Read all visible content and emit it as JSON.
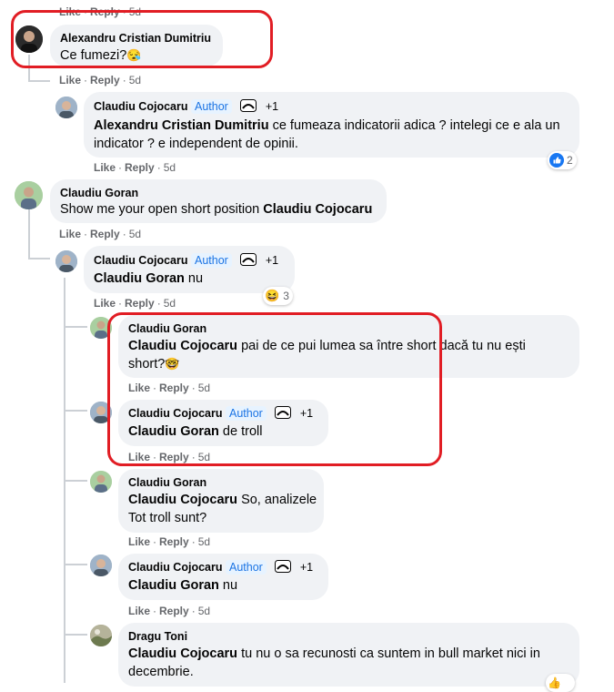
{
  "top_actions": {
    "like": "Like",
    "reply": "Reply",
    "time": "5d"
  },
  "c1": {
    "author": "Alexandru Cristian Dumitriu",
    "text": "Ce fumezi?",
    "emoji": "😪",
    "like": "Like",
    "reply": "Reply",
    "time": "5d"
  },
  "c2": {
    "author": "Claudiu Cojocaru",
    "badge": "Author",
    "plus": "+1",
    "mention": "Alexandru Cristian Dumitriu",
    "text1": " ce fumeaza indicatorii adica ? intelegi ce e ala un",
    "text2": "indicator ? e independent de opinii.",
    "like": "Like",
    "reply": "Reply",
    "time": "5d",
    "reaction_count": "2"
  },
  "c3": {
    "author": "Claudiu Goran",
    "text_pre": "Show me your open short position ",
    "mention": "Claudiu Cojocaru",
    "like": "Like",
    "reply": "Reply",
    "time": "5d"
  },
  "c4": {
    "author": "Claudiu Cojocaru",
    "badge": "Author",
    "plus": "+1",
    "mention": "Claudiu Goran",
    "text": " nu",
    "like": "Like",
    "reply": "Reply",
    "time": "5d",
    "reaction_count": "3"
  },
  "c5": {
    "author": "Claudiu Goran",
    "mention": "Claudiu Cojocaru",
    "text1": " pai de ce pui lumea sa între short dacă tu nu ești",
    "text2": "short?",
    "emoji": "🤓",
    "like": "Like",
    "reply": "Reply",
    "time": "5d"
  },
  "c6": {
    "author": "Claudiu Cojocaru",
    "badge": "Author",
    "plus": "+1",
    "mention": "Claudiu Goran",
    "text": " de troll",
    "like": "Like",
    "reply": "Reply",
    "time": "5d"
  },
  "c7": {
    "author": "Claudiu Goran",
    "mention": "Claudiu Cojocaru",
    "text1": " So, analizele",
    "text2": "Tot troll sunt?",
    "like": "Like",
    "reply": "Reply",
    "time": "5d"
  },
  "c8": {
    "author": "Claudiu Cojocaru",
    "badge": "Author",
    "plus": "+1",
    "mention": "Claudiu Goran",
    "text": " nu",
    "like": "Like",
    "reply": "Reply",
    "time": "5d"
  },
  "c9": {
    "author": "Dragu Toni",
    "mention": "Claudiu Cojocaru",
    "text1": " tu nu o sa recunosti ca suntem in bull market nici in",
    "text2": "decembrie."
  },
  "colors": {
    "bubble": "#f0f2f5",
    "highlight": "#e11d24",
    "author_badge": "#1b74e4",
    "meta": "#65676b"
  }
}
